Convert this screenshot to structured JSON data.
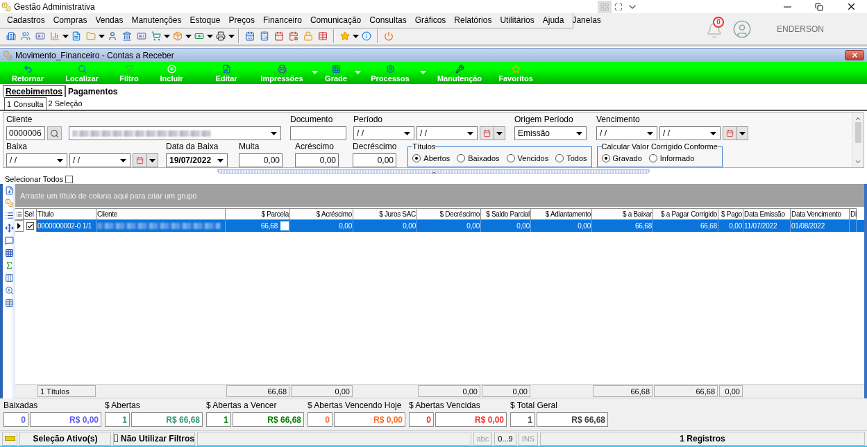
{
  "window": {
    "title": "Gestão Administrativa"
  },
  "menu": [
    "Cadastros",
    "Compras",
    "Vendas",
    "Manutenções",
    "Estoque",
    "Preços",
    "Financeiro",
    "Comunicação",
    "Consultas",
    "Gráficos",
    "Relatórios",
    "Utilitários",
    "Ajuda",
    "Janelas"
  ],
  "user": {
    "notifications": "0",
    "name": "ENDERSON"
  },
  "document": {
    "title": "Movimento_Financeiro - Contas a Receber"
  },
  "actions": [
    {
      "label": "Retornar",
      "dropdown": false
    },
    {
      "label": "Localizar",
      "dropdown": false
    },
    {
      "label": "Filtro",
      "dropdown": false
    },
    {
      "label": "Incluir",
      "dropdown": false
    },
    {
      "label": "Editar",
      "dropdown": false
    },
    {
      "label": "Impressões",
      "dropdown": true
    },
    {
      "label": "Grade",
      "dropdown": true
    },
    {
      "label": "Processos",
      "dropdown": true
    },
    {
      "label": "Manutenção",
      "dropdown": false
    },
    {
      "label": "Favoritos",
      "dropdown": false
    }
  ],
  "tabs": [
    {
      "label": "Recebimentos",
      "selected": true
    },
    {
      "label": "Pagamentos",
      "selected": false
    }
  ],
  "subtabs": [
    {
      "label": "1 Consulta",
      "selected": true
    },
    {
      "label": "2 Seleção",
      "selected": false
    }
  ],
  "filters": {
    "cliente": {
      "label": "Cliente",
      "code": "0000006"
    },
    "documento": {
      "label": "Documento"
    },
    "periodo": {
      "label": "Período",
      "from": "/ /",
      "to": "/ /"
    },
    "origem_periodo": {
      "label": "Origem Período",
      "value": "Emissão"
    },
    "vencimento": {
      "label": "Vencimento",
      "from": "/ /",
      "to": "/ /"
    },
    "baixa": {
      "label": "Baixa",
      "from": "/ /",
      "to": "/ /"
    },
    "data_baixa": {
      "label": "Data da Baixa",
      "value": "19/07/2022"
    },
    "multa": {
      "label": "Multa",
      "value": "0,00"
    },
    "acrescimo": {
      "label": "Acréscimo",
      "value": "0,00"
    },
    "decrescimo": {
      "label": "Decréscimo",
      "value": "0,00"
    },
    "titulos": {
      "label": "Títulos",
      "options": [
        {
          "label": "Abertos",
          "selected": true
        },
        {
          "label": "Baixados",
          "selected": false
        },
        {
          "label": "Vencidos",
          "selected": false
        },
        {
          "label": "Todos",
          "selected": false
        }
      ]
    },
    "calcular": {
      "label": "Calcular Valor Corrigido Conforme",
      "options": [
        {
          "label": "Gravado",
          "selected": true
        },
        {
          "label": "Informado",
          "selected": false
        }
      ]
    }
  },
  "select_all": {
    "label": "Selecionar Todos",
    "checked": false
  },
  "group_panel": {
    "hint": "Arraste um título de coluna aqui para criar um grupo"
  },
  "table": {
    "selection_header": "Sel",
    "columns": [
      "Título",
      "Cliente",
      "$ Parcela",
      "$ Acréscimo",
      "$ Juros SAC",
      "$ Decréscimo",
      "$ Saldo Parcial",
      "$ Adiantamento",
      "$ a Baixar",
      "$ a Pagar Corrigido",
      "$ Pago",
      "Data Emissão",
      "Data Vencimento",
      "Di"
    ],
    "rows": [
      {
        "selected": true,
        "checked": true,
        "cells": [
          "0000000002-0 1/1",
          null,
          "66,68",
          "0,00",
          "0,00",
          "0,00",
          "0,00",
          "0,00",
          "66,68",
          "66,68",
          "0,00",
          "11/07/2022",
          "01/08/2022"
        ]
      }
    ]
  },
  "grid_totals": {
    "titulo": "1 Títulos",
    "parcela": "66,68",
    "acrescimo": "0,00",
    "decrescimo": "0,00",
    "saldo_parcial": "0,00",
    "a_baixar": "66,68",
    "a_pagar_corrigido": "66,68",
    "pago": "0,00"
  },
  "summary": [
    {
      "label": "Baixadas",
      "count": "0",
      "amount": "R$ 0,00",
      "color": "#5a5aff"
    },
    {
      "label": "$ Abertas",
      "count": "1",
      "amount": "R$ 66,68",
      "color": "#2a9a78"
    },
    {
      "label": "$ Abertas a Vencer",
      "count": "1",
      "amount": "R$ 66,68",
      "color": "#008000"
    },
    {
      "label": "$ Abertas Vencendo Hoje",
      "count": "0",
      "amount": "R$ 0,00",
      "color": "#ff6a20"
    },
    {
      "label": "$ Abertas Vencidas",
      "count": "0",
      "amount": "R$ 0,00",
      "color": "#ff2a2a"
    },
    {
      "label": "$ Total Geral",
      "count": "1",
      "amount": "R$ 66,68",
      "color": "#404040"
    }
  ],
  "status_bar": {
    "selection": "Seleção Ativo(s)",
    "no_filters": {
      "label": "Não Utilizar Filtros",
      "checked": false
    },
    "indicators": [
      {
        "label": "abc",
        "on": false
      },
      {
        "label": "0...9",
        "on": true
      },
      {
        "label": "INS",
        "on": false
      }
    ],
    "records": "1 Registros"
  }
}
